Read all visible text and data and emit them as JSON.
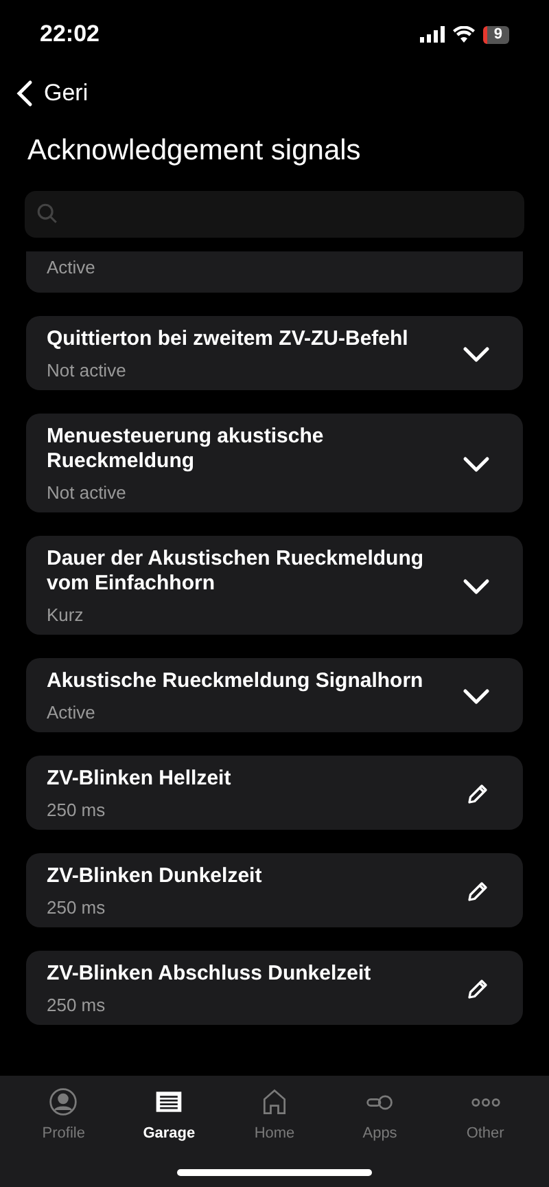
{
  "status_bar": {
    "time": "22:02",
    "battery": "9"
  },
  "nav": {
    "back": "Geri"
  },
  "title": "Acknowledgement signals",
  "settings": [
    {
      "value": "Active",
      "kind": "cut"
    },
    {
      "label": "Quittierton bei zweitem ZV-ZU-Befehl",
      "value": "Not active",
      "kind": "expand"
    },
    {
      "label": "Menuesteuerung akustische Rueckmeldung",
      "value": "Not active",
      "kind": "expand"
    },
    {
      "label": "Dauer der Akustischen Rueckmeldung vom Einfachhorn",
      "value": "Kurz",
      "kind": "expand"
    },
    {
      "label": "Akustische Rueckmeldung Signalhorn",
      "value": "Active",
      "kind": "expand"
    },
    {
      "label": "ZV-Blinken Hellzeit",
      "value": "250 ms",
      "kind": "edit"
    },
    {
      "label": "ZV-Blinken Dunkelzeit",
      "value": "250 ms",
      "kind": "edit"
    },
    {
      "label": "ZV-Blinken Abschluss Dunkelzeit",
      "value": "250 ms",
      "kind": "edit"
    }
  ],
  "tab_bar": [
    {
      "label": "Profile",
      "kind": "profile",
      "selected": false
    },
    {
      "label": "Garage",
      "kind": "garage",
      "selected": true
    },
    {
      "label": "Home",
      "kind": "home",
      "selected": false
    },
    {
      "label": "Apps",
      "kind": "apps",
      "selected": false
    },
    {
      "label": "Other",
      "kind": "other",
      "selected": false
    }
  ]
}
